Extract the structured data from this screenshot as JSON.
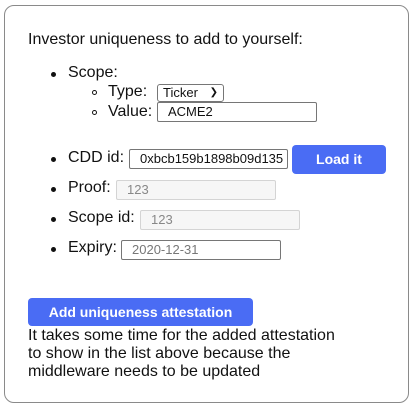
{
  "heading": "Investor uniqueness to add to yourself:",
  "scope": {
    "label": "Scope:",
    "type_label": "Type:",
    "type_value": "Ticker",
    "value_label": "Value:",
    "value_value": "ACME2"
  },
  "cdd": {
    "label": "CDD id:",
    "value": "0xbcb159b1898b09d135",
    "load_button": "Load it"
  },
  "proof": {
    "label": "Proof:",
    "value": "123"
  },
  "scope_id": {
    "label": "Scope id:",
    "value": "123"
  },
  "expiry": {
    "label": "Expiry:",
    "placeholder": "2020-12-31"
  },
  "add_button": "Add uniqueness attestation",
  "note_lines": [
    "It takes some time for the added attestation",
    "to show in the list above because the",
    "middleware needs to be updated"
  ],
  "colors": {
    "accent": "#4a6cf4"
  }
}
